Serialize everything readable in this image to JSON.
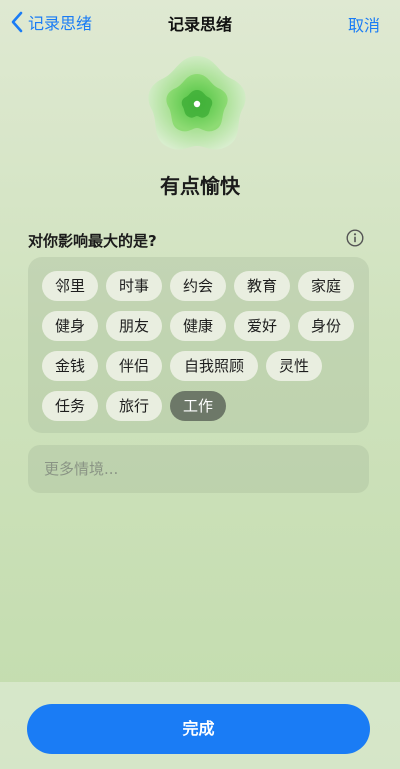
{
  "nav": {
    "back_label": "记录思绪",
    "title": "记录思绪",
    "cancel_label": "取消"
  },
  "mood": {
    "label": "有点愉快"
  },
  "question": {
    "text": "对你影响最大的是?"
  },
  "tags": [
    {
      "label": "邻里",
      "selected": false
    },
    {
      "label": "时事",
      "selected": false
    },
    {
      "label": "约会",
      "selected": false
    },
    {
      "label": "教育",
      "selected": false
    },
    {
      "label": "家庭",
      "selected": false
    },
    {
      "label": "健身",
      "selected": false
    },
    {
      "label": "朋友",
      "selected": false
    },
    {
      "label": "健康",
      "selected": false
    },
    {
      "label": "爱好",
      "selected": false
    },
    {
      "label": "身份",
      "selected": false
    },
    {
      "label": "金钱",
      "selected": false
    },
    {
      "label": "伴侣",
      "selected": false
    },
    {
      "label": "自我照顾",
      "selected": false
    },
    {
      "label": "灵性",
      "selected": false
    },
    {
      "label": "任务",
      "selected": false
    },
    {
      "label": "旅行",
      "selected": false
    },
    {
      "label": "工作",
      "selected": true
    }
  ],
  "more": {
    "placeholder": "更多情境..."
  },
  "footer": {
    "done_label": "完成"
  },
  "colors": {
    "accent": "#1a7cf5",
    "selected_tag": "#6d7868"
  }
}
